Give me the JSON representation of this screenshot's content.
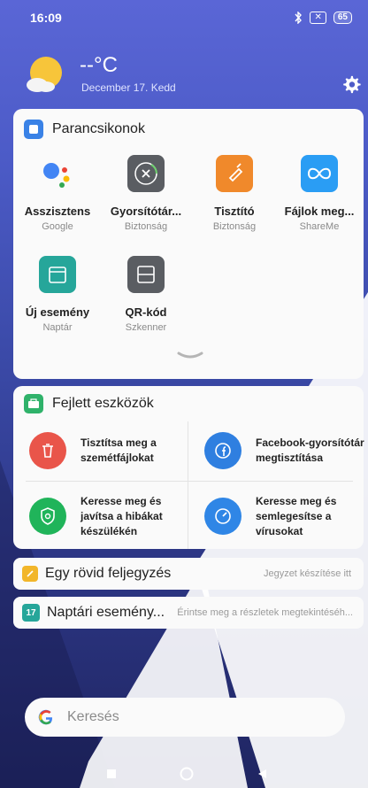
{
  "status_bar": {
    "time": "16:09",
    "sim": "✕",
    "battery": "65"
  },
  "weather": {
    "temperature": "--°C",
    "date": "December 17. Kedd"
  },
  "shortcuts_card": {
    "title": "Parancsikonok",
    "items": [
      {
        "label": "Asszisztens",
        "sublabel": "Google",
        "icon": "google-assistant-icon"
      },
      {
        "label": "Gyorsítótár...",
        "sublabel": "Biztonság",
        "icon": "cache-clear-icon"
      },
      {
        "label": "Tisztító",
        "sublabel": "Biztonság",
        "icon": "cleaner-icon"
      },
      {
        "label": "Fájlok meg...",
        "sublabel": "ShareMe",
        "icon": "shareme-icon"
      },
      {
        "label": "Új esemény",
        "sublabel": "Naptár",
        "icon": "calendar-icon"
      },
      {
        "label": "QR-kód",
        "sublabel": "Szkenner",
        "icon": "qr-scanner-icon"
      }
    ]
  },
  "tools_card": {
    "title": "Fejlett eszközök",
    "items": [
      {
        "label": "Tisztítsa meg a szemétfájlokat",
        "color": "#e9554a",
        "icon": "trash-icon"
      },
      {
        "label": "Facebook-gyorsítótár megtisztítása",
        "color": "#2f7fe0",
        "icon": "facebook-cleaner-icon"
      },
      {
        "label": "Keresse meg és javítsa a hibákat készülékén",
        "color": "#20b45a",
        "icon": "shield-icon"
      },
      {
        "label": "Keresse meg és semlegesítse a vírusokat",
        "color": "#2f86e6",
        "icon": "virus-scan-icon"
      }
    ]
  },
  "note_card": {
    "title": "Egy rövid feljegyzés",
    "hint": "Jegyzet készítése itt"
  },
  "calendar_card": {
    "badge": "17",
    "title": "Naptári esemény...",
    "hint": "Érintse meg a részletek megtekintéséh..."
  },
  "search": {
    "placeholder": "Keresés"
  },
  "colors": {
    "accent_blue": "#3a82e6",
    "notes_yellow": "#f2b62a",
    "tools_green": "#2fb26a",
    "calendar_teal": "#26a69a"
  }
}
